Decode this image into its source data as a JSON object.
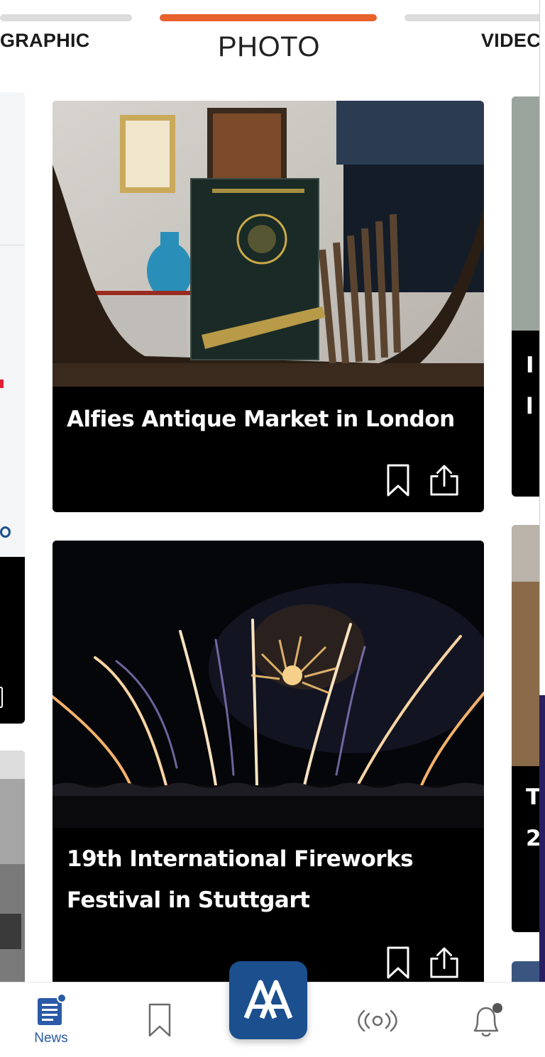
{
  "tabs": {
    "left": "GRAPHIC",
    "active": "PHOTO",
    "right": "VIDEC"
  },
  "cards": [
    {
      "title": "Alfies Antique Market in London"
    },
    {
      "title_line1": "19th International Fireworks",
      "title_line2": "Festival in Stuttgart"
    }
  ],
  "right_peek": {
    "card1_line1": "I",
    "card1_line2": "l",
    "card2_line1": "T",
    "card2_line2": "2"
  },
  "nav": {
    "news_label": "News",
    "logo_text": "AA"
  },
  "colors": {
    "accent": "#e8622c",
    "brand": "#1b4f8e",
    "nav_active": "#2a5aa8"
  },
  "icons": [
    "bookmark-icon",
    "share-icon",
    "news-icon",
    "live-radio-icon",
    "notification-bell-icon"
  ]
}
